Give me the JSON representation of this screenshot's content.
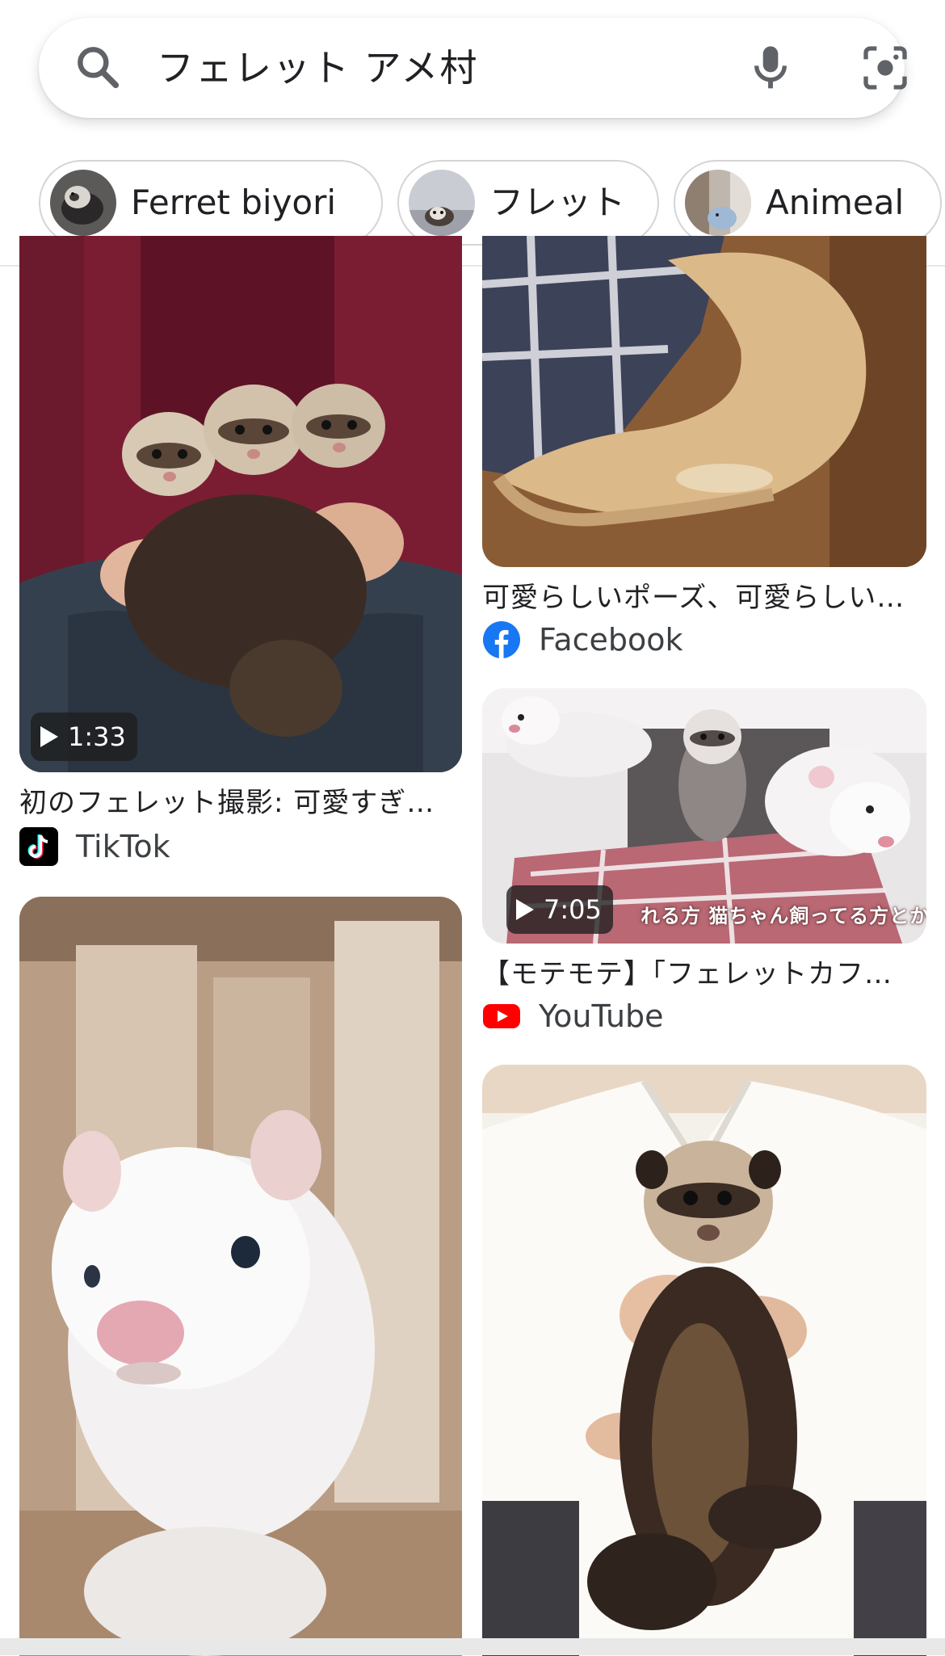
{
  "search": {
    "query": "フェレット アメ村"
  },
  "chips": [
    {
      "label": "Ferret biyori"
    },
    {
      "label": "フレット"
    },
    {
      "label": "Animeal"
    }
  ],
  "results": {
    "left": [
      {
        "duration": "1:33",
        "title": "初のフェレット撮影: 可愛すぎ…",
        "source": "TikTok"
      }
    ],
    "right": [
      {
        "title": "可愛らしいポーズ、可愛らしい…",
        "source": "Facebook"
      },
      {
        "duration": "7:05",
        "title": "【モテモテ】「フェレットカフ…",
        "source": "YouTube",
        "overlay_text": "れる方 猫ちゃん飼ってる方とか"
      }
    ]
  },
  "colors": {
    "facebook": "#1877f2",
    "youtube": "#ff0000",
    "tiktok": "#000000"
  }
}
